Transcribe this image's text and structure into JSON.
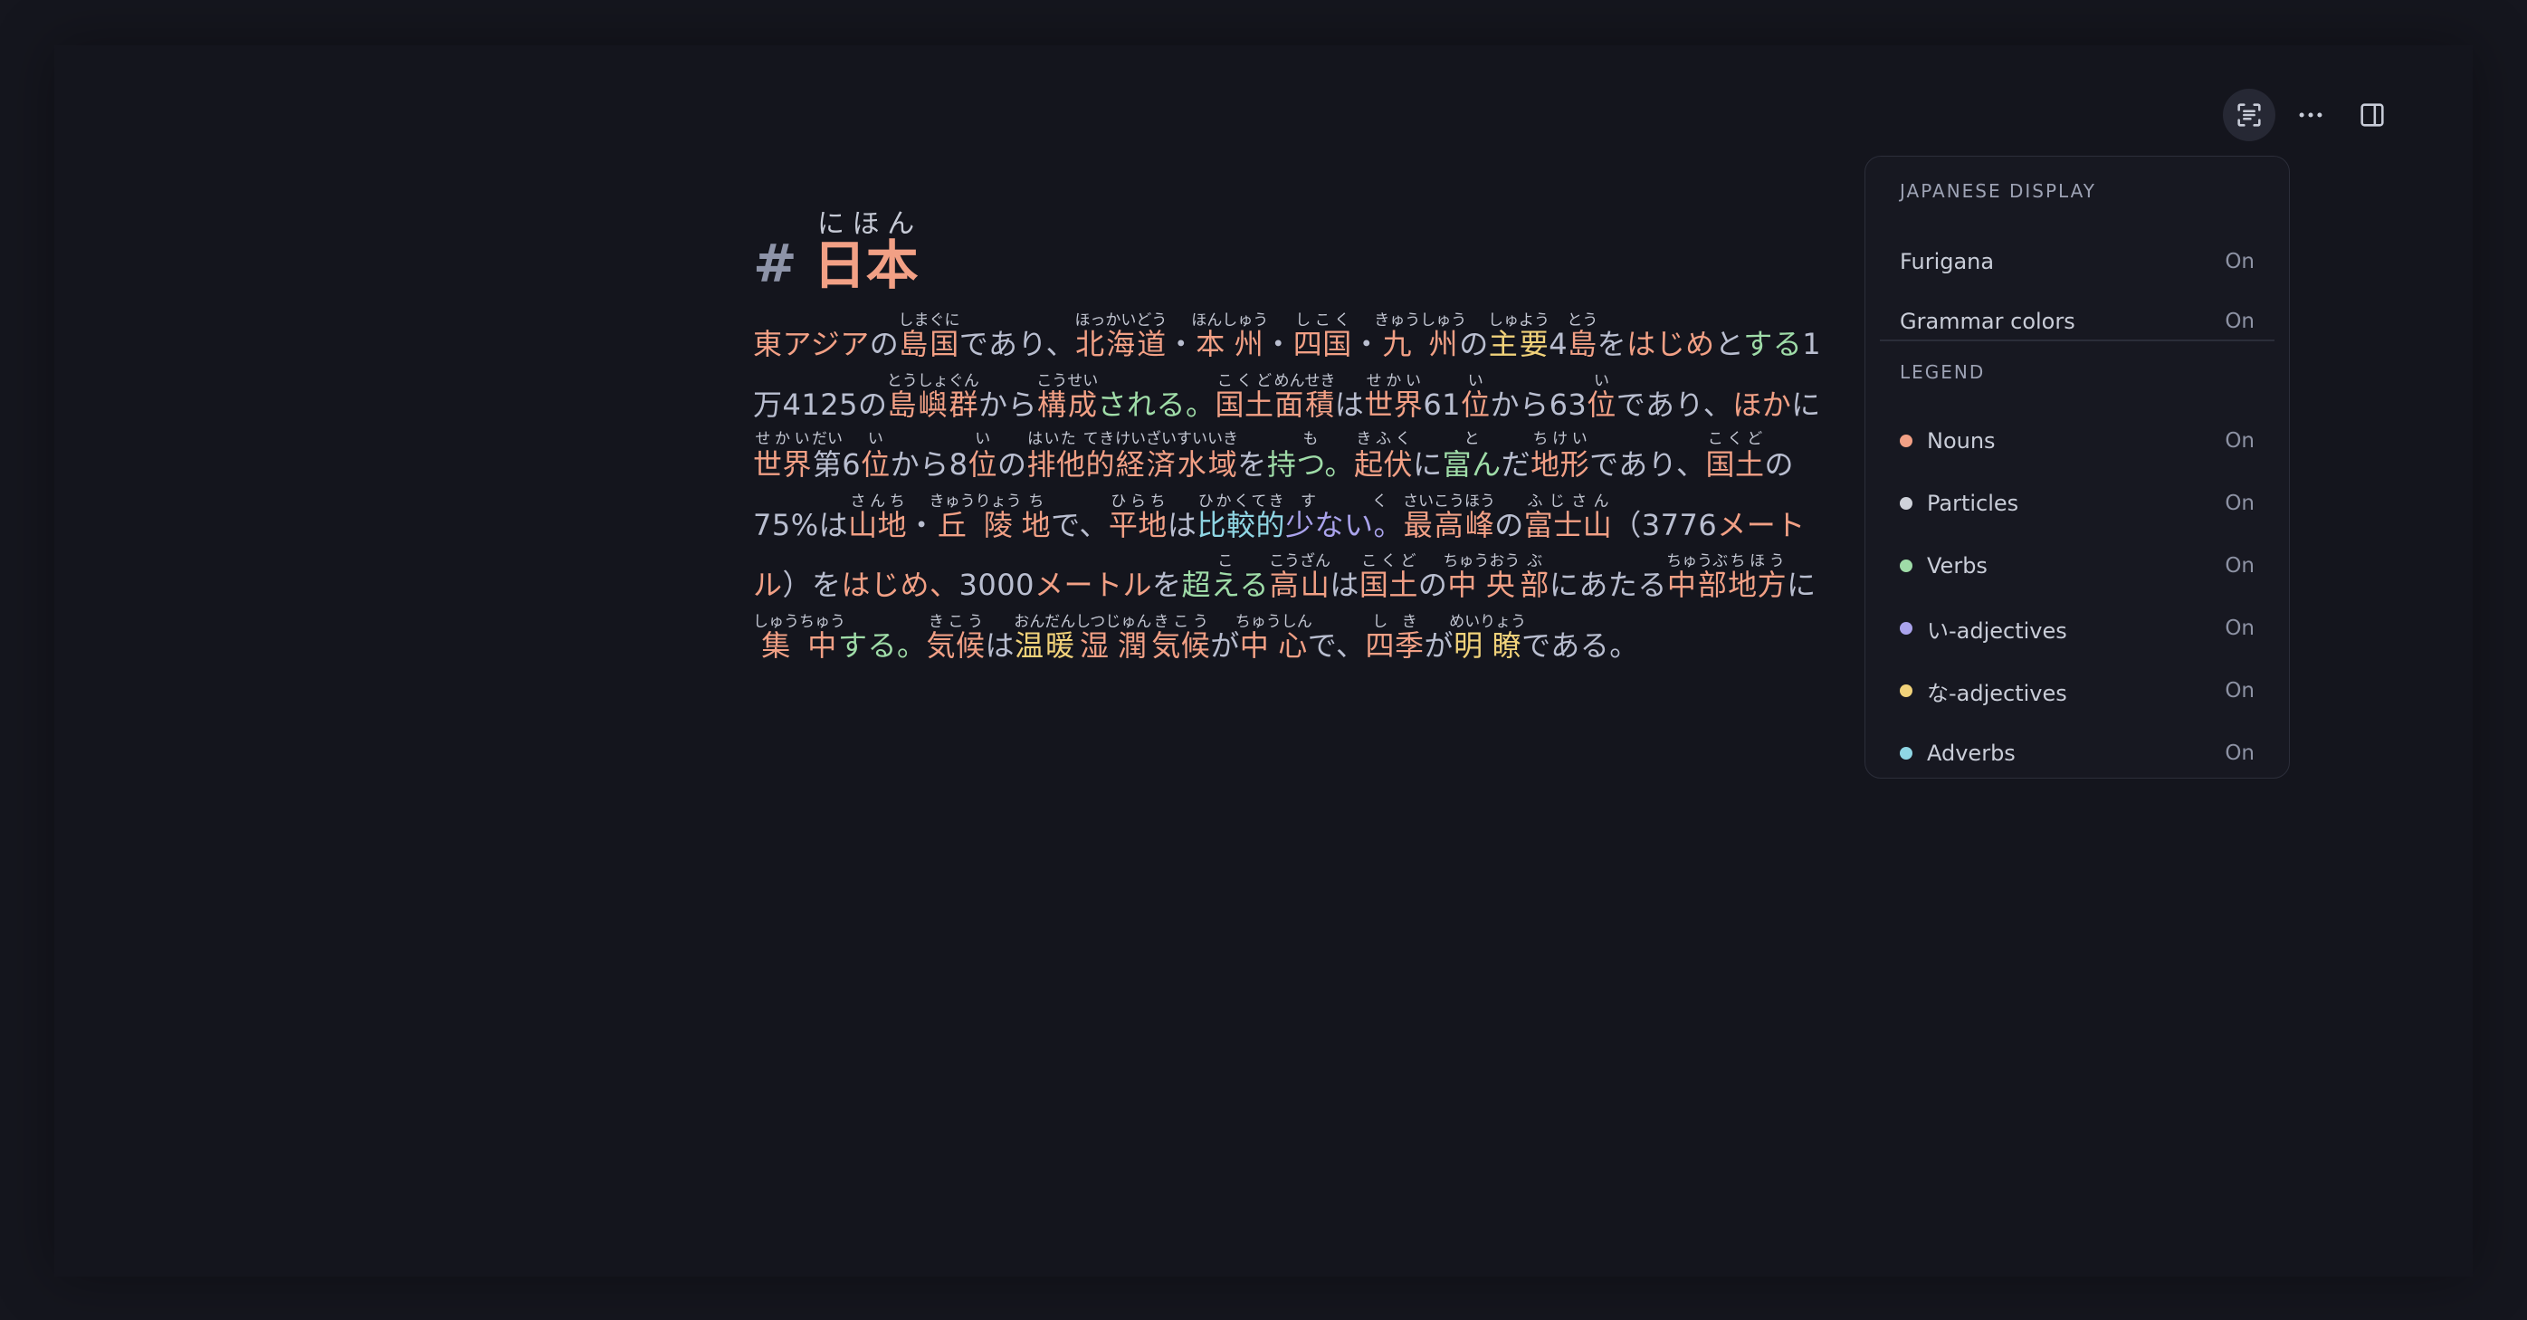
{
  "toolbar": {
    "icons": [
      "text-recognition-icon",
      "more-icon",
      "sidebar-toggle-icon"
    ]
  },
  "document": {
    "heading_marker": "#",
    "title": "日本",
    "title_reading": "にほん"
  },
  "settings_panel": {
    "display_section": {
      "title": "JAPANESE DISPLAY",
      "items": [
        {
          "label": "Furigana",
          "state": "On"
        },
        {
          "label": "Grammar colors",
          "state": "On"
        }
      ]
    },
    "legend_section": {
      "title": "LEGEND",
      "items": [
        {
          "label": "Nouns",
          "state": "On",
          "color": "#f2a085"
        },
        {
          "label": "Particles",
          "state": "On",
          "color": "#cfd2da"
        },
        {
          "label": "Verbs",
          "state": "On",
          "color": "#9fdca8"
        },
        {
          "label": "い-adjectives",
          "state": "On",
          "color": "#aaa3ec"
        },
        {
          "label": "な-adjectives",
          "state": "On",
          "color": "#f1d27a"
        },
        {
          "label": "Adverbs",
          "state": "On",
          "color": "#8fd6e4"
        }
      ]
    }
  },
  "body_tokens": [
    {
      "t": "東アジア",
      "c": "n"
    },
    {
      "t": "の",
      "c": "p"
    },
    {
      "t": "島国",
      "r": "しまぐに",
      "c": "n"
    },
    {
      "t": "であり、",
      "c": "p"
    },
    {
      "t": "北海道",
      "r": "ほっかいどう",
      "c": "n"
    },
    {
      "t": "・",
      "c": "p"
    },
    {
      "t": "本州",
      "r": "ほんしゅう",
      "c": "n"
    },
    {
      "t": "・",
      "c": "p"
    },
    {
      "t": "四国",
      "r": "しこく",
      "c": "n"
    },
    {
      "t": "・",
      "c": "p"
    },
    {
      "t": "九州",
      "r": "きゅうしゅう",
      "c": "n"
    },
    {
      "t": "の",
      "c": "p"
    },
    {
      "t": "主要",
      "r": "しゅよう",
      "c": "na"
    },
    {
      "t": "4",
      "c": "p"
    },
    {
      "t": "島",
      "r": "とう",
      "c": "n"
    },
    {
      "t": "を",
      "c": "p"
    },
    {
      "t": "はじめ",
      "c": "n"
    },
    {
      "t": "と",
      "c": "p"
    },
    {
      "t": "する",
      "c": "v"
    },
    {
      "t": "1万4125",
      "c": "p"
    },
    {
      "t": "の",
      "c": "p"
    },
    {
      "t": "島嶼",
      "r": "とうしょ",
      "c": "n"
    },
    {
      "t": "群",
      "r": "ぐん",
      "c": "n"
    },
    {
      "t": "から",
      "c": "p"
    },
    {
      "t": "構成",
      "r": "こうせい",
      "c": "n"
    },
    {
      "t": "される。",
      "c": "v"
    },
    {
      "t": "国土",
      "r": "こくど",
      "c": "n"
    },
    {
      "t": "面積",
      "r": "めんせき",
      "c": "n"
    },
    {
      "t": "は",
      "c": "p"
    },
    {
      "t": "世界",
      "r": "せかい",
      "c": "n"
    },
    {
      "t": "61",
      "c": "p"
    },
    {
      "t": "位",
      "r": "い",
      "c": "n"
    },
    {
      "t": "から",
      "c": "p"
    },
    {
      "t": "63",
      "c": "p"
    },
    {
      "t": "位",
      "r": "い",
      "c": "n"
    },
    {
      "t": "であり、",
      "c": "p"
    },
    {
      "t": "ほか",
      "c": "n"
    },
    {
      "t": "に",
      "c": "p"
    },
    {
      "t": "世界",
      "r": "せかい",
      "c": "n"
    },
    {
      "t": "第",
      "r": "だい",
      "c": "p"
    },
    {
      "t": "6",
      "c": "p"
    },
    {
      "t": "位",
      "r": "い",
      "c": "n"
    },
    {
      "t": "から",
      "c": "p"
    },
    {
      "t": "8",
      "c": "p"
    },
    {
      "t": "位",
      "r": "い",
      "c": "n"
    },
    {
      "t": "の",
      "c": "p"
    },
    {
      "t": "排他的",
      "r": "はいた てき",
      "c": "n"
    },
    {
      "t": "経済",
      "r": "けいざい",
      "c": "n"
    },
    {
      "t": "水域",
      "r": "すいいき",
      "c": "n"
    },
    {
      "t": "を",
      "c": "p"
    },
    {
      "t": "持つ。",
      "r": "も",
      "c": "v"
    },
    {
      "t": "起伏",
      "r": "きふく",
      "c": "n"
    },
    {
      "t": "に",
      "c": "p"
    },
    {
      "t": "富ん",
      "r": "と",
      "c": "v"
    },
    {
      "t": "だ",
      "c": "p"
    },
    {
      "t": "地形",
      "r": "ちけい",
      "c": "n"
    },
    {
      "t": "であり、",
      "c": "p"
    },
    {
      "t": "国土",
      "r": "こくど",
      "c": "n"
    },
    {
      "t": "の",
      "c": "p"
    },
    {
      "t": "75%",
      "c": "p"
    },
    {
      "t": "は",
      "c": "p"
    },
    {
      "t": "山地",
      "r": "さんち",
      "c": "n"
    },
    {
      "t": "・",
      "c": "p"
    },
    {
      "t": "丘陵",
      "r": "きゅうりょう",
      "c": "n"
    },
    {
      "t": "地",
      "r": "ち",
      "c": "n"
    },
    {
      "t": "で、",
      "c": "p"
    },
    {
      "t": "平地",
      "r": "ひらち",
      "c": "n"
    },
    {
      "t": "は",
      "c": "p"
    },
    {
      "t": "比較的",
      "r": "ひかくてき",
      "c": "adv"
    },
    {
      "t": "少ない。",
      "r": "すく",
      "c": "i"
    },
    {
      "t": "最高峰",
      "r": "さいこうほう",
      "c": "n"
    },
    {
      "t": "の",
      "c": "p"
    },
    {
      "t": "富士山",
      "r": "ふじさん",
      "c": "n"
    },
    {
      "t": "（3776",
      "c": "p"
    },
    {
      "t": "メートル",
      "c": "n"
    },
    {
      "t": "）を",
      "c": "p"
    },
    {
      "t": "はじめ、",
      "c": "n"
    },
    {
      "t": "3000",
      "c": "p"
    },
    {
      "t": "メートル",
      "c": "n"
    },
    {
      "t": "を",
      "c": "p"
    },
    {
      "t": "超える",
      "r": "こ",
      "c": "v"
    },
    {
      "t": "高山",
      "r": "こうざん",
      "c": "n"
    },
    {
      "t": "は",
      "c": "p"
    },
    {
      "t": "国土",
      "r": "こくど",
      "c": "n"
    },
    {
      "t": "の",
      "c": "p"
    },
    {
      "t": "中央",
      "r": "ちゅうおう",
      "c": "n"
    },
    {
      "t": "部",
      "r": "ぶ",
      "c": "n"
    },
    {
      "t": "にあたる",
      "c": "p"
    },
    {
      "t": "中部",
      "r": "ちゅうぶ",
      "c": "n"
    },
    {
      "t": "地方",
      "r": "ちほう",
      "c": "n"
    },
    {
      "t": "に",
      "c": "p"
    },
    {
      "t": "集中",
      "r": "しゅうちゅう",
      "c": "n"
    },
    {
      "t": "する。",
      "c": "v"
    },
    {
      "t": "気候",
      "r": "きこう",
      "c": "n"
    },
    {
      "t": "は",
      "c": "p"
    },
    {
      "t": "温暖",
      "r": "おんだん",
      "c": "na"
    },
    {
      "t": "湿潤",
      "r": "しつじゅん",
      "c": "n"
    },
    {
      "t": "気候",
      "r": "きこう",
      "c": "n"
    },
    {
      "t": "が",
      "c": "p"
    },
    {
      "t": "中心",
      "r": "ちゅうしん",
      "c": "n"
    },
    {
      "t": "で、",
      "c": "p"
    },
    {
      "t": "四季",
      "r": "しき",
      "c": "n"
    },
    {
      "t": "が",
      "c": "p"
    },
    {
      "t": "明瞭",
      "r": "めいりょう",
      "c": "na"
    },
    {
      "t": "である。",
      "c": "p"
    }
  ]
}
